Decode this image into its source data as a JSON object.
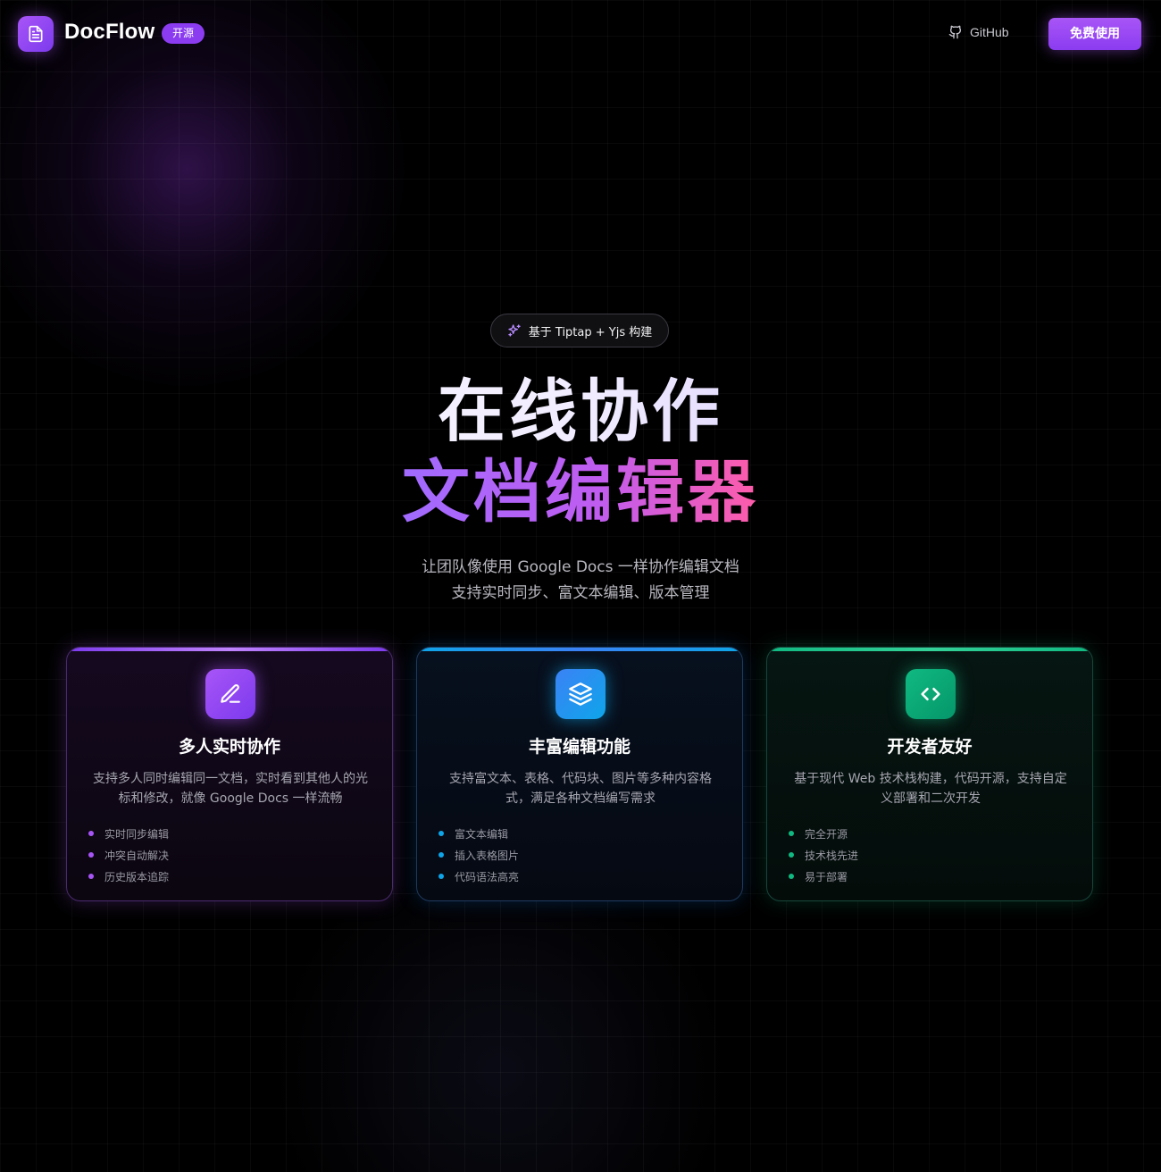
{
  "header": {
    "brand": "DocFlow",
    "badge": "开源",
    "github_label": "GitHub",
    "cta_label": "免费使用"
  },
  "hero": {
    "pill": "基于 Tiptap + Yjs 构建",
    "title_line1": "在线协作",
    "title_line2": "文档编辑器",
    "subtitle_line1": "让团队像使用 Google Docs 一样协作编辑文档",
    "subtitle_line2": "支持实时同步、富文本编辑、版本管理"
  },
  "cards": [
    {
      "title": "多人实时协作",
      "description": "支持多人同时编辑同一文档，实时看到其他人的光标和修改，就像 Google Docs 一样流畅",
      "features": [
        "实时同步编辑",
        "冲突自动解决",
        "历史版本追踪"
      ],
      "icon": "pen-icon",
      "accent": "#a855f7"
    },
    {
      "title": "丰富编辑功能",
      "description": "支持富文本、表格、代码块、图片等多种内容格式，满足各种文档编写需求",
      "features": [
        "富文本编辑",
        "插入表格图片",
        "代码语法高亮"
      ],
      "icon": "layers-icon",
      "accent": "#0ea5e9"
    },
    {
      "title": "开发者友好",
      "description": "基于现代 Web 技术栈构建，代码开源，支持自定义部署和二次开发",
      "features": [
        "完全开源",
        "技术栈先进",
        "易于部署"
      ],
      "icon": "code-icon",
      "accent": "#10b981"
    }
  ]
}
